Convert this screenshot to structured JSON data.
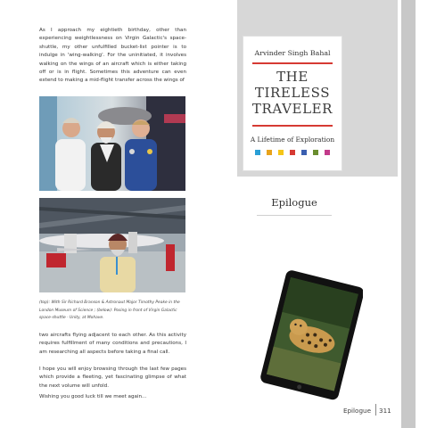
{
  "body_text": {
    "paragraph_1": "As I approach my eightieth birthday, other than experiencing weightlessness on Virgin Galactic's space-shuttle, my other unfulfilled bucket-list pointer is to indulge in 'wing-walking'. For the uninitiated, it involves walking on the wings of an aircraft which is either taking off or is in flight. Sometimes this adventure can even extend to making a mid-flight transfer across the wings of",
    "paragraph_2": "two aircrafts flying adjacent to each other. As this activity requires fulfillment of many conditions and precautions, I am researching all aspects before taking a final call.",
    "paragraph_3": "I hope you will enjoy browsing through the last few pages which provide a fleeting, yet fascinating glimpse of what the next volume will unfold.",
    "paragraph_4": "Wishing you good luck till we meet again..."
  },
  "caption": "(top): With Sir Richard Branson & Astronaut Major Timothy Peake in the London Museum of Science ; (below): Posing in front of Virgin Galactic space-shuttle - Unity, at Mohave.",
  "book_cover": {
    "author": "Arvinder Singh Bahal",
    "title_line_1": "THE",
    "title_line_2": "TIRELESS",
    "title_line_3": "TRAVELER",
    "subtitle": "A Lifetime of Exploration",
    "swatch_colors": [
      "#2a9fd6",
      "#e8a31c",
      "#f5c518",
      "#d63a33",
      "#3a5fb0",
      "#6a8d2e",
      "#c23a8a"
    ]
  },
  "section_heading": "Epilogue",
  "footer": {
    "label": "Epilogue",
    "page_number": "311"
  },
  "colors": {
    "accent_red": "#d63a33",
    "panel_gray": "#d7d7d7",
    "edge_gray": "#c8c8c8"
  }
}
